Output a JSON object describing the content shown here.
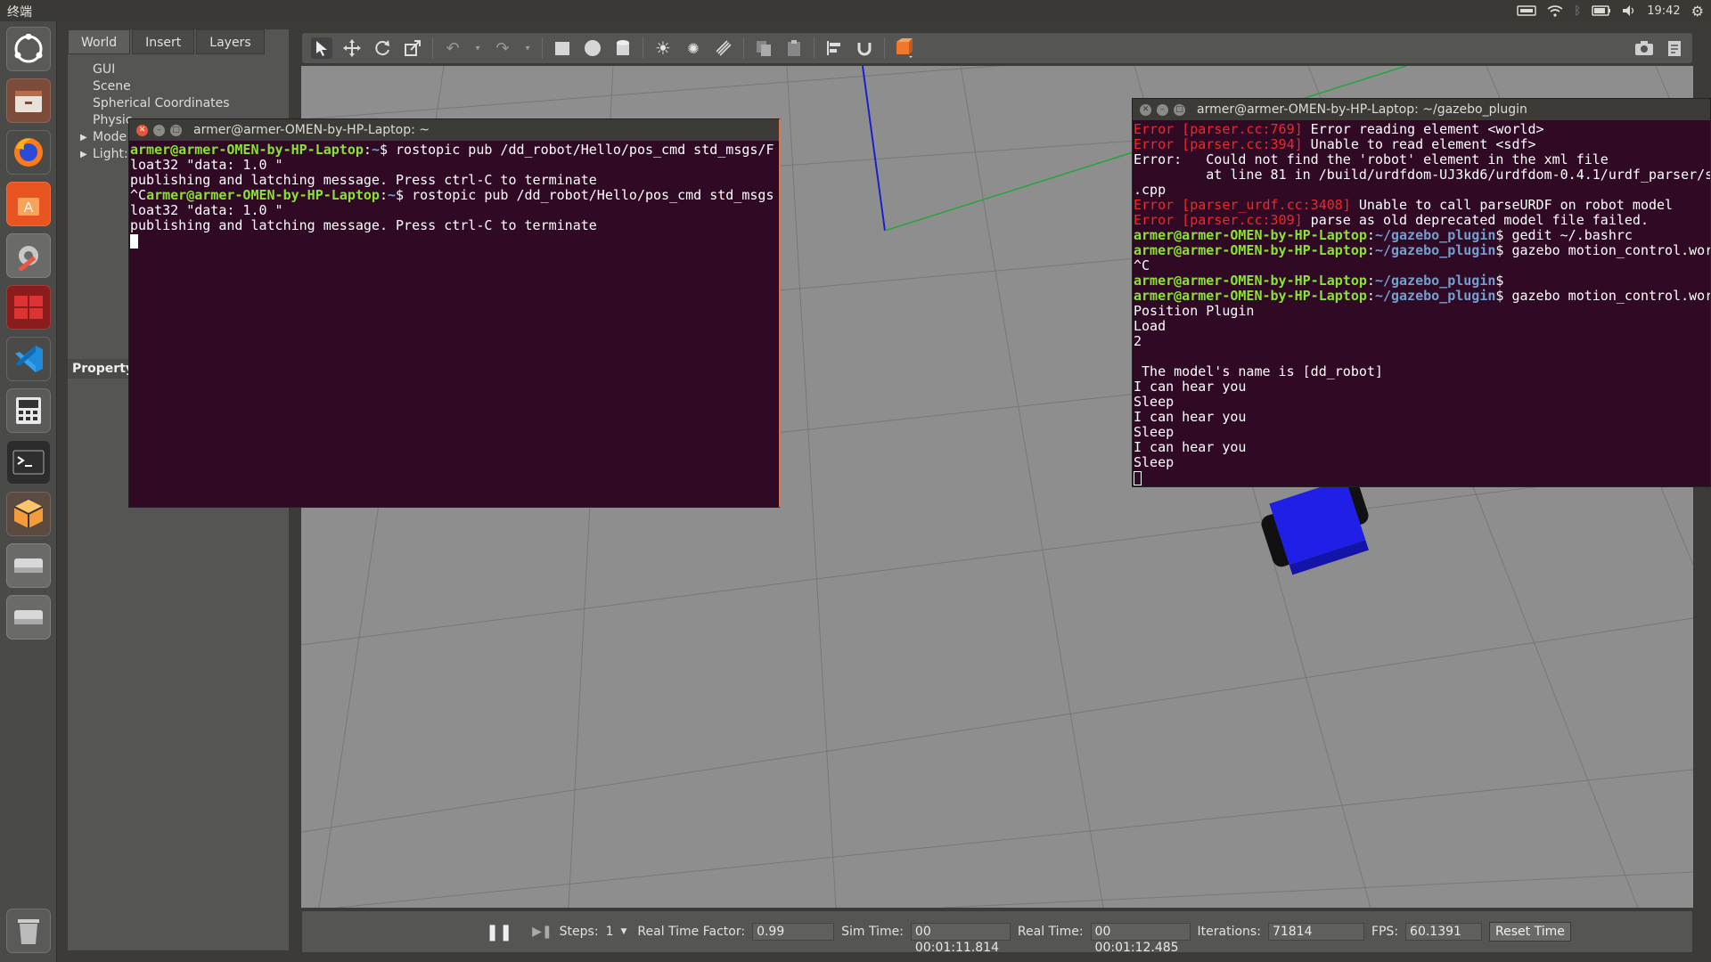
{
  "top_panel": {
    "title": "终端",
    "clock": "19:42"
  },
  "launcher": {
    "icons": [
      "ubuntu-dash-icon",
      "files-icon",
      "firefox-icon",
      "software-center-icon",
      "system-settings-icon",
      "workspace-switcher-icon",
      "vscode-icon",
      "system-monitor-icon",
      "terminal-icon",
      "gazebo-icon",
      "drive-icon",
      "drive-icon-2",
      "trash-icon"
    ]
  },
  "gazebo": {
    "left_tabs": [
      "World",
      "Insert",
      "Layers"
    ],
    "tree": [
      {
        "label": "GUI",
        "expandable": false
      },
      {
        "label": "Scene",
        "expandable": false
      },
      {
        "label": "Spherical Coordinates",
        "expandable": false
      },
      {
        "label": "Physic",
        "expandable": false
      },
      {
        "label": "Mode",
        "expandable": true
      },
      {
        "label": "Light:",
        "expandable": true
      }
    ],
    "property_label": "Property",
    "bottom": {
      "steps_label": "Steps:",
      "steps_value": "1",
      "rtf_label": "Real Time Factor:",
      "rtf_value": "0.99",
      "sim_label": "Sim Time:",
      "sim_value": "00 00:01:11.814",
      "real_label": "Real Time:",
      "real_value": "00 00:01:12.485",
      "iter_label": "Iterations:",
      "iter_value": "71814",
      "fps_label": "FPS:",
      "fps_value": "60.1391",
      "reset_label": "Reset Time"
    }
  },
  "terminal1": {
    "title": "armer@armer-OMEN-by-HP-Laptop: ~",
    "user": "armer@armer-OMEN-by-HP-Laptop",
    "path": "~",
    "line1_cmd": " rostopic pub /dd_robot/Hello/pos_cmd std_msgs/F",
    "line2": "loat32 \"data: 1.0 \"",
    "line3": "publishing and latching message. Press ctrl-C to terminate",
    "line4_prefix": "^C",
    "line4_cmd": " rostopic pub /dd_robot/Hello/pos_cmd std_msgs",
    "line5": "loat32 \"data: 1.0 \"",
    "line6": "publishing and latching message. Press ctrl-C to terminate"
  },
  "terminal2": {
    "title": "armer@armer-OMEN-by-HP-Laptop: ~/gazebo_plugin",
    "user": "armer@armer-OMEN-by-HP-Laptop",
    "path": "~/gazebo_plugin",
    "err1_tag": "Error [parser.cc:769]",
    "err1_msg": " Error reading element <world>",
    "err2_tag": "Error [parser.cc:394]",
    "err2_msg": " Unable to read element <sdf>",
    "err3": "Error:   Could not find the 'robot' element in the xml file",
    "err3b": "         at line 81 in /build/urdfdom-UJ3kd6/urdfdom-0.4.1/urdf_parser/s",
    "err3c": ".cpp",
    "err4_tag": "Error [parser_urdf.cc:3408]",
    "err4_msg": " Unable to call parseURDF on robot model",
    "err5_tag": "Error [parser.cc:309]",
    "err5_msg": " parse as old deprecated model file failed.",
    "cmd1": " gedit ~/.bashrc",
    "cmd2": " gazebo motion_control.wor",
    "ctrlc": "^C",
    "cmd3": "",
    "cmd4": " gazebo motion_control.wor",
    "out": [
      "Position Plugin",
      "Load",
      "2",
      "",
      "The model's name is [dd_robot]",
      "I can hear you",
      "Sleep",
      "I can hear you",
      "Sleep",
      "I can hear you",
      "Sleep"
    ]
  }
}
